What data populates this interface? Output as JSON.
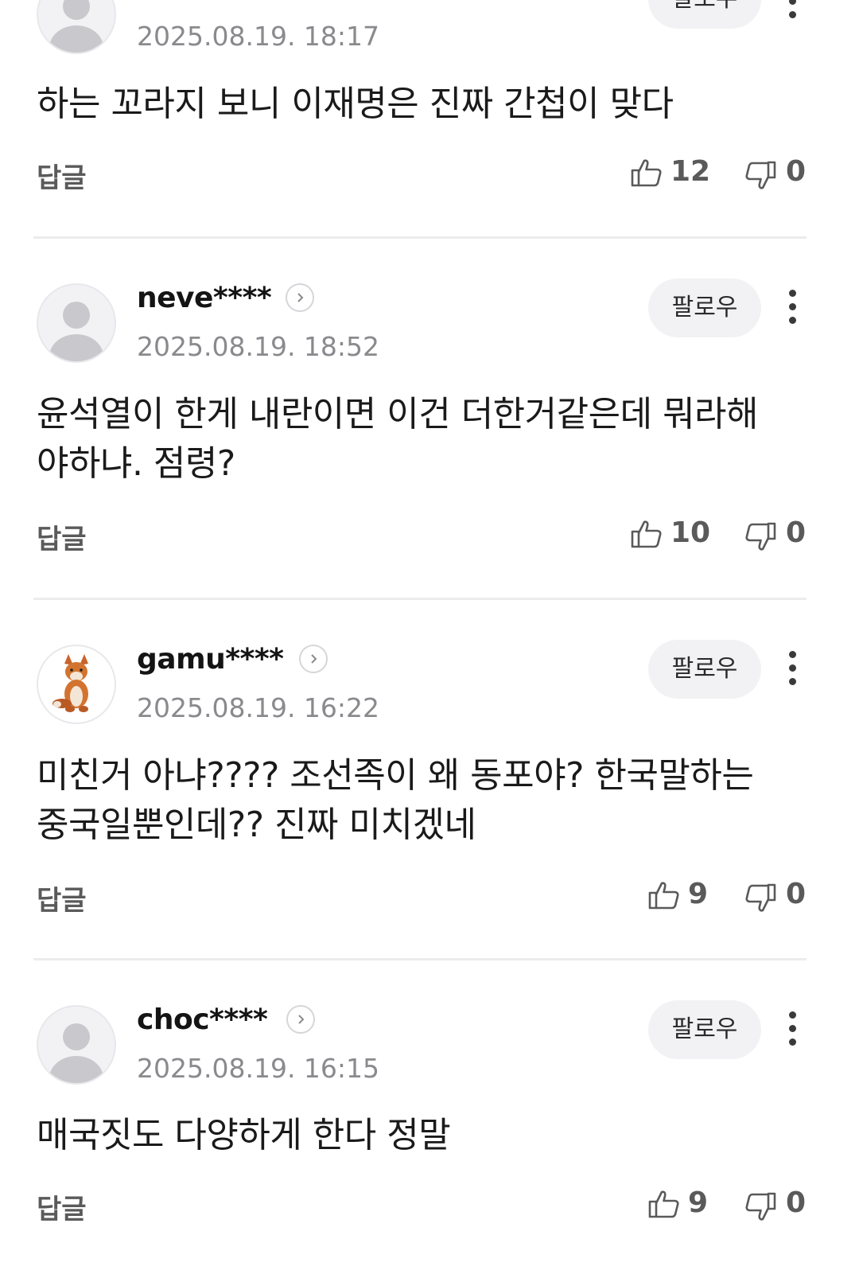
{
  "comments": [
    {
      "username": "",
      "timestamp": "2025.08.19. 18:17",
      "text": "하는 꼬라지 보니 이재명은 진짜 간첩이 맞다",
      "likes": "12",
      "dislikes": "0",
      "follow_label": "팔로우",
      "reply_label": "답글",
      "avatar_icon": "default-user-icon"
    },
    {
      "username": "neve****",
      "timestamp": "2025.08.19. 18:52",
      "text": "윤석열이 한게 내란이면 이건 더한거같은데 뭐라해야하냐. 점령?",
      "likes": "10",
      "dislikes": "0",
      "follow_label": "팔로우",
      "reply_label": "답글",
      "avatar_icon": "default-user-icon"
    },
    {
      "username": "gamu****",
      "timestamp": "2025.08.19. 16:22",
      "text": "미친거 아냐???? 조선족이 왜 동포야? 한국말하는 중국일뿐인데?? 진짜 미치겠네",
      "likes": "9",
      "dislikes": "0",
      "follow_label": "팔로우",
      "reply_label": "답글",
      "avatar_icon": "fox-plush-icon"
    },
    {
      "username": "choc****",
      "timestamp": "2025.08.19. 16:15",
      "text": "매국짓도 다양하게 한다 정말",
      "likes": "9",
      "dislikes": "0",
      "follow_label": "팔로우",
      "reply_label": "답글",
      "avatar_icon": "default-user-icon"
    }
  ],
  "colors": {
    "text": "#1a1a1a",
    "meta": "#8a8a8e",
    "action": "#5a5a5a",
    "follow_bg": "#f2f2f4",
    "avatar_bg": "#f2f2f5",
    "avatar_figure": "#c9c9cd",
    "divider": "#ececee"
  }
}
